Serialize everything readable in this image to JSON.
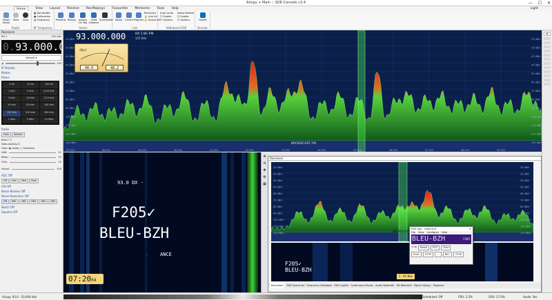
{
  "app": {
    "title": "Airspy + Main :: SDR Console v3.4",
    "win_buttons": [
      "—",
      "☐",
      "✕"
    ]
  },
  "menu": {
    "items": [
      "Home",
      "View",
      "Layout",
      "Receive",
      "Rec/Replays",
      "Favourites",
      "Memories",
      "Tools",
      "Help"
    ],
    "theme_label": "Light"
  },
  "ribbon": {
    "radio": {
      "group_label": "Radio",
      "buttons": [
        "Select Radio",
        "Start",
        "Stop"
      ]
    },
    "rf": {
      "group_label": "RF Frequency",
      "items": [
        "Bandwidth",
        "Calibration",
        "Frequency"
      ]
    },
    "select": {
      "group_label": "Select",
      "buttons": [
        "Previous",
        "History",
        "Always On Top",
        "Child Instance",
        "Screenshot"
      ]
    },
    "link": {
      "group_label": "Link",
      "buttons": [
        "Radio",
        "Centre",
        "Program"
      ],
      "items": [
        "Receivers",
        "Link All",
        "Unlock All"
      ]
    },
    "dsp": {
      "group_label": "Wideband DSP",
      "items": [
        "Auto-mute",
        "Enable",
        "Options",
        "Noise Blanker",
        "Enable",
        "Options"
      ]
    },
    "donate": {
      "group_label": "Donate",
      "button": "PayPal"
    }
  },
  "left_panel": {
    "header": "Receivers",
    "rx_label": "RX 1",
    "rx_bw": "125 kHz",
    "frequency": "93.000.000",
    "mode_default": "Default",
    "volume_value": "100",
    "sections": {
      "ip_display": "IP Display",
      "modes": "Modes",
      "filters": "Filters",
      "radio": "Radio",
      "agc": "AGC Off",
      "cw": "CW Off",
      "noise_blanker": "Noise Blanker Off",
      "noise_reduction": "Noise Reduction Off",
      "notch": "Notch Off",
      "squelch": "Squelch Off"
    },
    "step_buttons": [
      "1 Hz",
      "10 Hz",
      "100 Hz",
      "1 kHz",
      "5 kHz",
      "6.25 kHz",
      "9 kHz",
      "10 kHz",
      "12.5 kHz",
      "25 kHz",
      "50 kHz",
      "100 kHz",
      "125 kHz",
      "200 kHz",
      "500 kHz",
      "1 MHz",
      "5 MHz",
      "10 MHz"
    ],
    "tabs": [
      "Help",
      "Options"
    ],
    "bias_t": "Bias-T",
    "data_locking": "Data-locking",
    "gain": [
      "Gain:",
      "Linear",
      "Sensitive"
    ],
    "gains": [
      {
        "label": "LNA:",
        "value": "21"
      },
      {
        "label": "Mixer:",
        "value": "22"
      },
      {
        "label": "VGA:",
        "value": "22"
      }
    ],
    "visual": "Visual:",
    "visual_value": "100",
    "agc_modes": [
      "Off",
      "Fast",
      "Med",
      "Slow"
    ],
    "nr_modes": [
      "Off",
      "NR1",
      "NR2",
      "NR3",
      "NR4",
      "NR5"
    ]
  },
  "main_display": {
    "frequency": "93.000.000",
    "rx": "RX 1",
    "mode": "BC-FM",
    "bw": "125 kHz",
    "meter_left": "40.9",
    "meter_right": "48.2",
    "band_label": "BROADCAST FM",
    "db_ticks": [
      "-10 dBm",
      "-20 dBm",
      "-30 dBm",
      "-40 dBm",
      "-50 dBm",
      "-60 dBm",
      "-70 dBm",
      "-80 dBm",
      "-90 dBm",
      "-100 dBm",
      "-110 dBm",
      "-120 dBm",
      "-130 dBm"
    ],
    "freq_ticks": [
      "87.000",
      "88.000",
      "89.000",
      "90.000",
      "91.000",
      "92.000",
      "93.000",
      "94.000",
      "95.000",
      "96.000",
      "97.000",
      "98.000",
      "99.000"
    ]
  },
  "rds": {
    "top_line": "93.0  DX  -",
    "ps_line1": "F205✓",
    "ps_line2": "BLEU-BZH",
    "radiotext": "ANCE",
    "clock": "07:20",
    "clock_sec": "04"
  },
  "rx_window": {
    "band_label": "BROADCAST FM",
    "db_ticks": [
      "-20 dBm",
      "-30 dBm",
      "-40 dBm",
      "-50 dBm",
      "-60 dBm",
      "-70 dBm",
      "-80 dBm",
      "-90 dBm",
      "-100 dBm",
      "-110 dBm",
      "-120 dBm"
    ],
    "rds_mini_line1": "F205✓",
    "rds_mini_line2": "BLEU-BZH",
    "tabs": [
      "Receivers",
      "RDS Spectrum",
      "Frequency Database",
      "RDS Logfile",
      "Continuous Moves",
      "Audio Waterfall",
      "3D Waterfall",
      "Signal History",
      "Playback"
    ],
    "timestamp": "1 · 01 Nov"
  },
  "vendor_popup": {
    "title": "RDS Spy - radio-tv.fr",
    "menu": [
      "File",
      "View",
      "Configure",
      "Help"
    ],
    "ps": "BLEU-BZH",
    "pi": "F205",
    "reset_label": "Reset",
    "source_label": "RTZ",
    "tune_label": "Tune",
    "btn_play": "PLAY",
    "btn_stop": "STOP",
    "btn_rec": "REC",
    "btn_stop2": "STOP",
    "btn_more": "...",
    "status": "1 Hz"
  },
  "status_bar": {
    "left": "Airspy: 93.0 · 10,000 kHz",
    "center_left": "Scheduled: Off",
    "cpu": "CPU: 2.2%",
    "gpu": "GPU: 27.0%",
    "audio": "Audio: Yes"
  },
  "colors": {
    "accent": "#1a5fb4",
    "spectrum_bg": "#0a1f4a",
    "signal_green": "#2fbf3c",
    "signal_red": "#e02020",
    "rds_yellow": "#f3d57a"
  }
}
